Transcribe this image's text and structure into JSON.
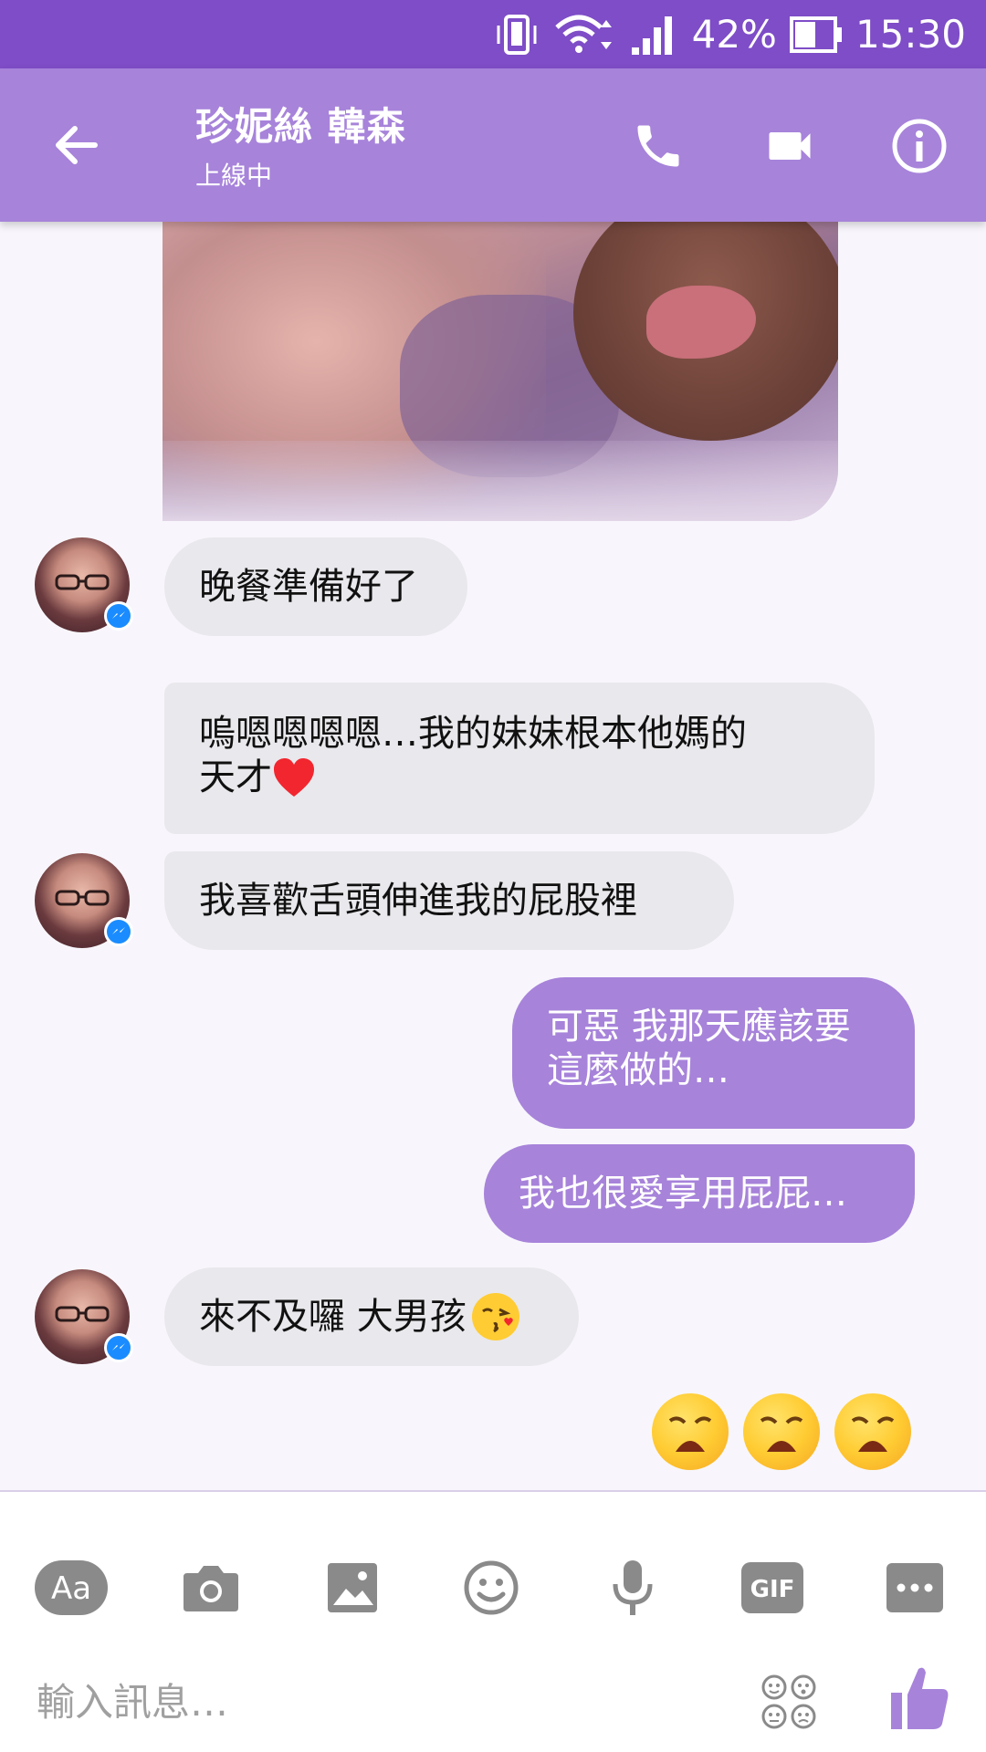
{
  "status_bar": {
    "battery": "42%",
    "time": "15:30"
  },
  "header": {
    "contact_name": "珍妮絲 韓森",
    "contact_status": "上線中"
  },
  "messages": [
    {
      "type": "image"
    },
    {
      "type": "incoming",
      "text": "晚餐準備好了"
    },
    {
      "type": "incoming",
      "text_line1": "嗚嗯嗯嗯嗯…我的妹妹根本他媽的",
      "text_line2": "天才"
    },
    {
      "type": "incoming",
      "text": "我喜歡舌頭伸進我的屁股裡"
    },
    {
      "type": "outgoing",
      "text_line1": "可惡 我那天應該要",
      "text_line2": "這麼做的…"
    },
    {
      "type": "outgoing",
      "text": "我也很愛享用屁屁…"
    },
    {
      "type": "incoming",
      "text": "來不及囉 大男孩"
    },
    {
      "type": "emoji_reply",
      "emojis": [
        "weary-face",
        "weary-face",
        "weary-face"
      ]
    }
  ],
  "toolbar": {
    "aa_label": "Aa",
    "gif_label": "GIF",
    "input_placeholder": "輸入訊息…"
  },
  "colors": {
    "status_bar": "#7e4dc7",
    "header": "#a783da",
    "outgoing_bubble": "#a783da",
    "incoming_bubble": "#e9e8ec",
    "icon_gray": "#8a8a8a"
  }
}
